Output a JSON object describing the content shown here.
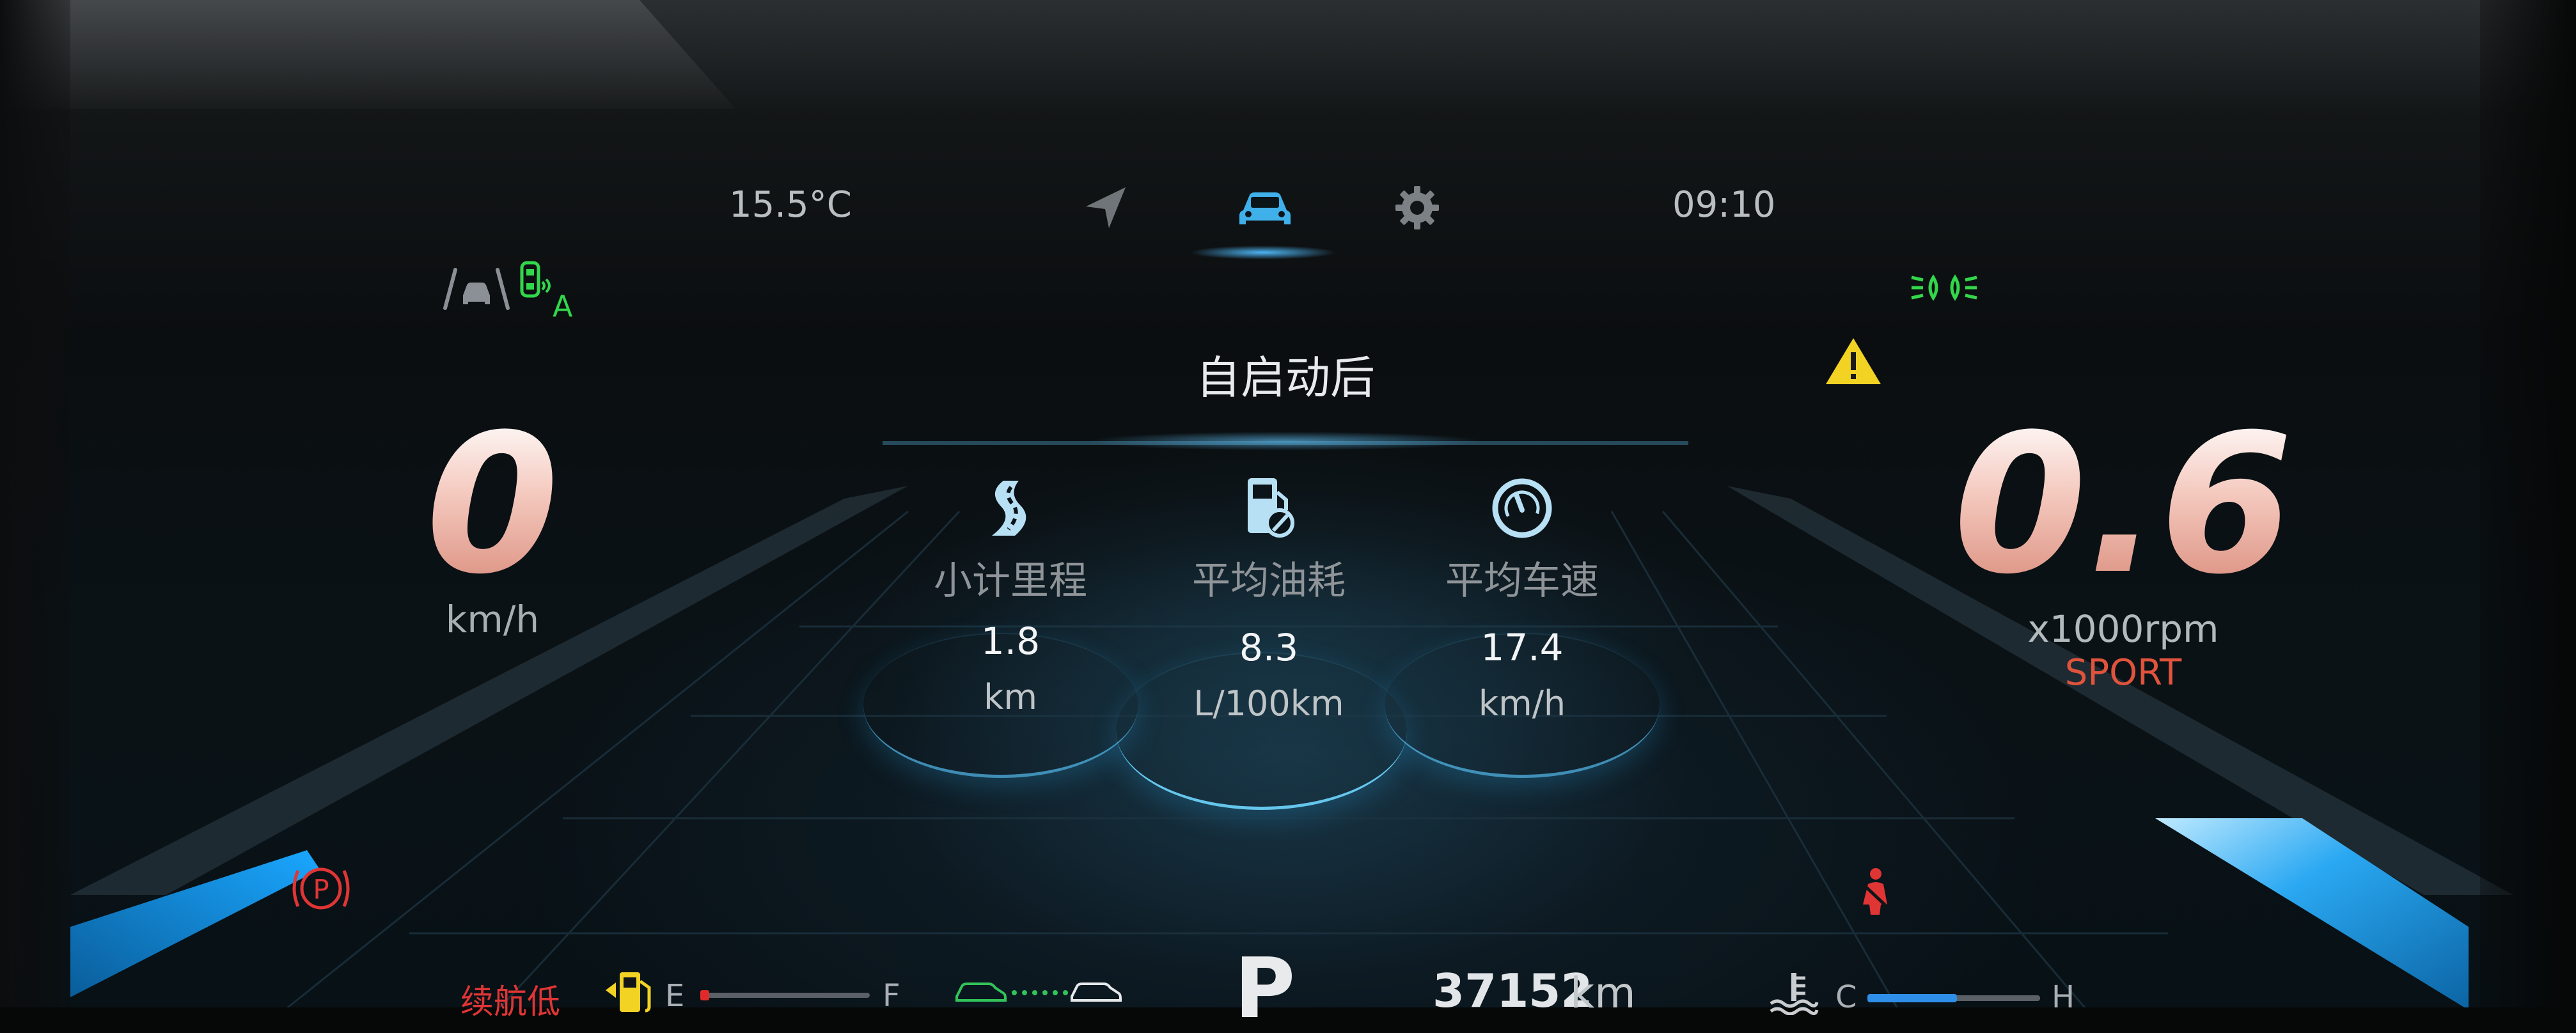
{
  "top_bar": {
    "outside_temp": "15.5°C",
    "clock": "09:10",
    "tabs": [
      {
        "icon": "navigation-arrow-icon",
        "active": false
      },
      {
        "icon": "car-icon",
        "active": true,
        "color": "#3fb0ea"
      },
      {
        "icon": "gear-icon",
        "active": false
      }
    ]
  },
  "indicators": {
    "lane_assist_icon": "lane-assist-icon",
    "auto_hold_icon": "auto-hold-icon",
    "auto_hold_letter": "A",
    "position_lights_icon": "position-lights-icon",
    "warning_icon": "warning-triangle-icon",
    "parking_brake_icon": "parking-brake-icon",
    "parking_brake_letter": "P",
    "seatbelt_icon": "seatbelt-warning-icon"
  },
  "speedometer": {
    "value": "0",
    "unit": "km/h"
  },
  "tachometer": {
    "value": "0.6",
    "unit": "x1000rpm",
    "mode": "SPORT"
  },
  "trip": {
    "title": "自启动后",
    "items": [
      {
        "icon": "road-icon",
        "label": "小计里程",
        "value": "1.8",
        "unit": "km"
      },
      {
        "icon": "fuel-consumption-icon",
        "label": "平均油耗",
        "value": "8.3",
        "unit": "L/100km"
      },
      {
        "icon": "gauge-icon",
        "label": "平均车速",
        "value": "17.4",
        "unit": "km/h"
      }
    ]
  },
  "status_bar": {
    "range_warning": "续航低",
    "fuel_icon": "fuel-pump-icon",
    "fuel_empty_label": "E",
    "fuel_full_label": "F",
    "fuel_level": 0.03,
    "cruise_icon": "following-distance-icon",
    "gear": "P",
    "odometer_value": "37152",
    "odometer_unit": "km",
    "coolant_icon": "coolant-temperature-icon",
    "temp_cold_label": "C",
    "temp_hot_label": "H",
    "coolant_level": 0.52
  },
  "colors": {
    "accent": "#3fb0ea",
    "warning_red": "#e03535",
    "indicator_green": "#32d74b",
    "warning_yellow": "#f2d324",
    "sport_red": "#e0533c"
  }
}
